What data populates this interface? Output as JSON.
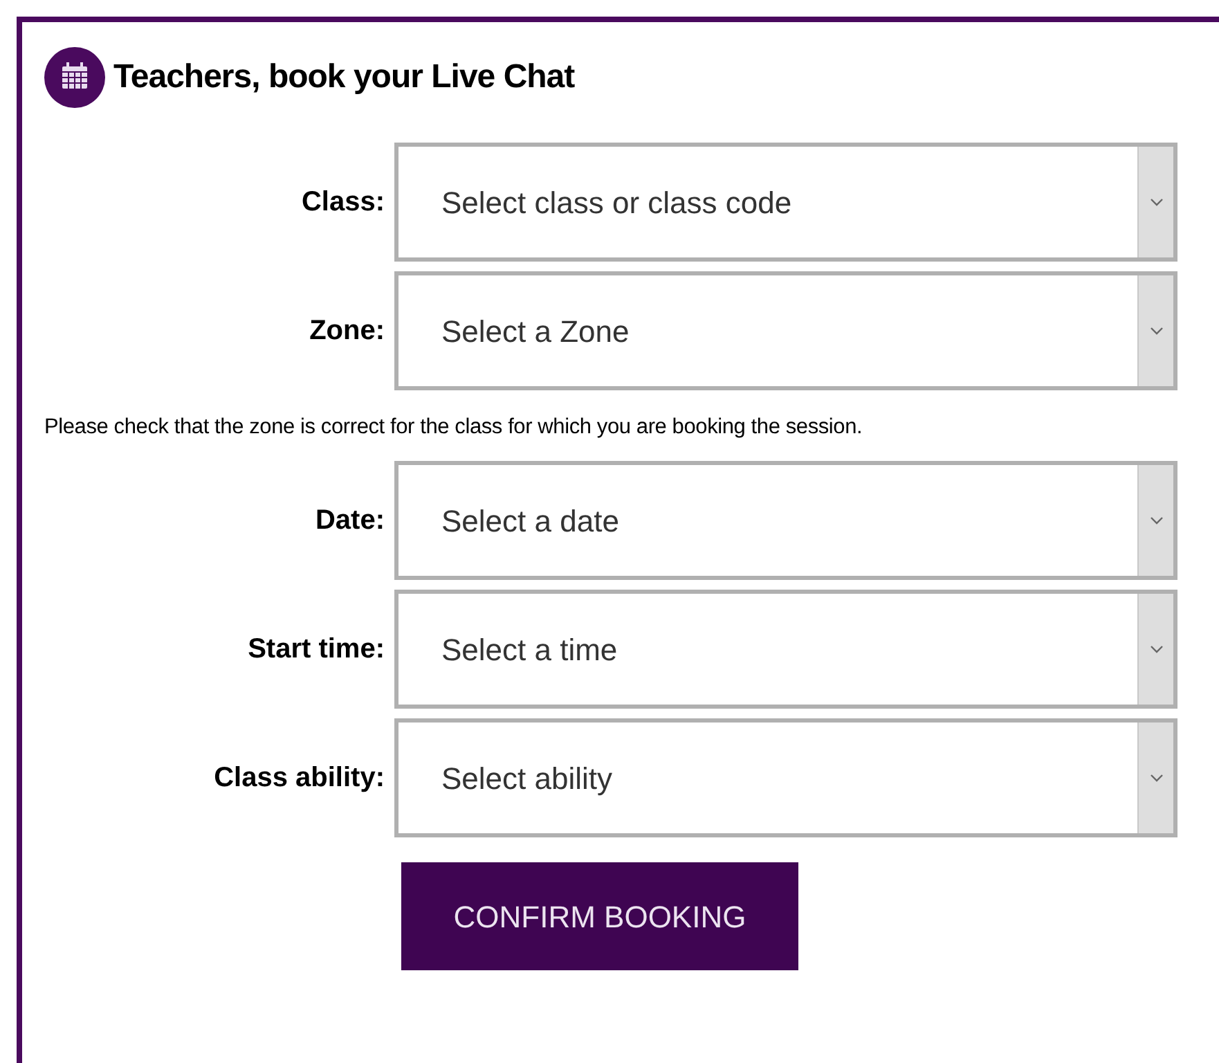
{
  "heading": "Teachers, book your Live Chat",
  "fields": [
    {
      "label": "Class:",
      "placeholder": "Select class or class code"
    },
    {
      "label": "Zone:",
      "placeholder": "Select a Zone"
    },
    {
      "label": "Date:",
      "placeholder": "Select a date"
    },
    {
      "label": "Start time:",
      "placeholder": "Select a time"
    },
    {
      "label": "Class ability:",
      "placeholder": "Select ability"
    }
  ],
  "note": "Please check that the zone is correct for the class for which you are booking the session.",
  "submit": "CONFIRM BOOKING"
}
